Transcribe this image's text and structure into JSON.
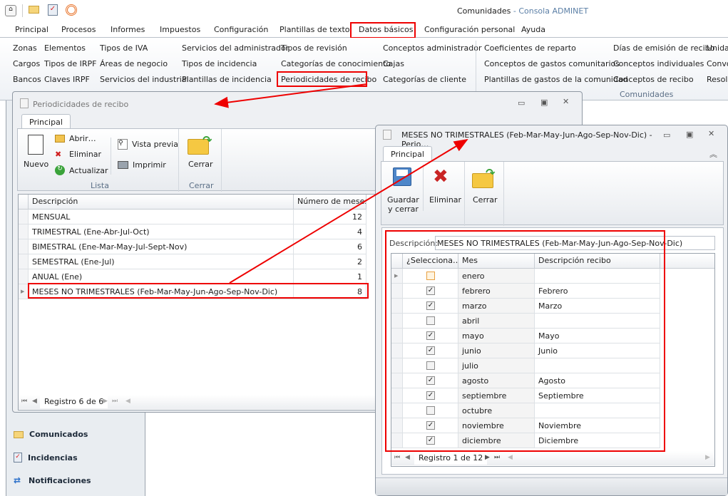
{
  "app": {
    "title_doc": "Comunidades",
    "title_sep": " - ",
    "title_app": "Consola ADMINET"
  },
  "quick_access": [
    "app-icon",
    "mail-icon",
    "clipboard-icon",
    "broadcast-icon"
  ],
  "menu": [
    "Principal",
    "Procesos",
    "Informes",
    "Impuestos",
    "Configuración",
    "Plantillas de texto",
    "Datos básicos",
    "Configuración personal",
    "Ayuda"
  ],
  "ribbon": {
    "col1": [
      "Zonas",
      "Cargos",
      "Bancos"
    ],
    "col2": [
      "Elementos",
      "Tipos de IRPF",
      "Claves IRPF"
    ],
    "col3": [
      "Tipos de IVA",
      "Áreas de negocio",
      "Servicios del industrial"
    ],
    "col4": [
      "Servicios del administrador",
      "Tipos de incidencia",
      "Plantillas de incidencia"
    ],
    "col5": [
      "Tipos de revisión",
      "Categorías de conocimiento",
      "Periodicidades de recibo"
    ],
    "col6": [
      "Conceptos administrador",
      "Cajas",
      "Categorías de cliente"
    ],
    "col7": [
      "Coeficientes de reparto",
      "Conceptos de gastos comunitarios",
      "Plantillas de gastos de la comunidad"
    ],
    "col8": [
      "Días de emisión de recibo",
      "Conceptos individuales",
      "Conceptos de recibo"
    ],
    "col9": [
      "Unidad",
      "Convo",
      "Resolu"
    ],
    "group_label": "Comunidades"
  },
  "leftnav": [
    "Comunicados",
    "Incidencias",
    "Notificaciones"
  ],
  "win1": {
    "title": "Periodicidades de recibo",
    "tab": "Principal",
    "buttons": {
      "nuevo": "Nuevo",
      "abrir": "Abrir…",
      "eliminar": "Eliminar",
      "actualizar": "Actualizar",
      "vista_previa": "Vista previa",
      "imprimir": "Imprimir",
      "cerrar": "Cerrar"
    },
    "groups": {
      "lista": "Lista",
      "cerrar": "Cerrar"
    },
    "columns": [
      "Descripción",
      "Número de meses"
    ],
    "rows": [
      {
        "desc": "MENSUAL",
        "n": "12"
      },
      {
        "desc": "TRIMESTRAL (Ene-Abr-Jul-Oct)",
        "n": "4"
      },
      {
        "desc": "BIMESTRAL (Ene-Mar-May-Jul-Sept-Nov)",
        "n": "6"
      },
      {
        "desc": "SEMESTRAL (Ene-Jul)",
        "n": "2"
      },
      {
        "desc": "ANUAL (Ene)",
        "n": "1"
      },
      {
        "desc": "MESES NO TRIMESTRALES (Feb-Mar-May-Jun-Ago-Sep-Nov-Dic)",
        "n": "8"
      }
    ],
    "navigator": "Registro 6 de 6"
  },
  "win2": {
    "title": "MESES NO TRIMESTRALES (Feb-Mar-May-Jun-Ago-Sep-Nov-Dic) - Perio…",
    "tab": "Principal",
    "buttons": {
      "guardar1": "Guardar",
      "guardar2": "y cerrar",
      "eliminar": "Eliminar",
      "cerrar": "Cerrar"
    },
    "desc_label": "Descripción:",
    "desc_value": "MESES NO TRIMESTRALES (Feb-Mar-May-Jun-Ago-Sep-Nov-Dic)",
    "columns": [
      "¿Selecciona…",
      "Mes",
      "Descripción recibo"
    ],
    "rows": [
      {
        "sel": false,
        "mes": "enero",
        "desc": ""
      },
      {
        "sel": true,
        "mes": "febrero",
        "desc": "Febrero"
      },
      {
        "sel": true,
        "mes": "marzo",
        "desc": "Marzo"
      },
      {
        "sel": false,
        "mes": "abril",
        "desc": ""
      },
      {
        "sel": true,
        "mes": "mayo",
        "desc": "Mayo"
      },
      {
        "sel": true,
        "mes": "junio",
        "desc": "Junio"
      },
      {
        "sel": false,
        "mes": "julio",
        "desc": ""
      },
      {
        "sel": true,
        "mes": "agosto",
        "desc": "Agosto"
      },
      {
        "sel": true,
        "mes": "septiembre",
        "desc": "Septiembre"
      },
      {
        "sel": false,
        "mes": "octubre",
        "desc": ""
      },
      {
        "sel": true,
        "mes": "noviembre",
        "desc": "Noviembre"
      },
      {
        "sel": true,
        "mes": "diciembre",
        "desc": "Diciembre"
      }
    ],
    "navigator": "Registro 1 de 12"
  },
  "colors": {
    "highlight": "#e00000",
    "title_accent": "#5b7fa6"
  }
}
